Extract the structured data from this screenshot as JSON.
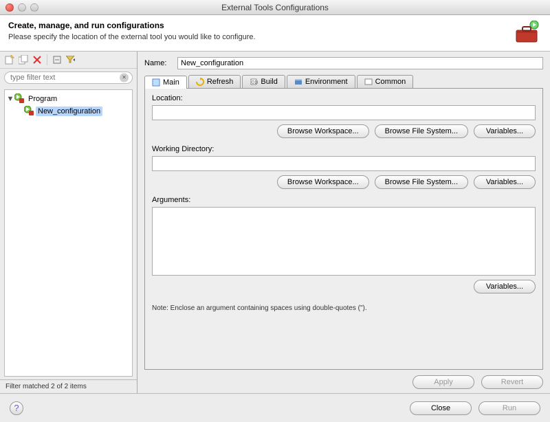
{
  "window": {
    "title": "External Tools Configurations"
  },
  "header": {
    "title": "Create, manage, and run configurations",
    "subtitle": "Please specify the location of the external tool you would like to configure."
  },
  "toolbar": {
    "icons": [
      "new-icon",
      "duplicate-icon",
      "delete-icon",
      "collapse-icon",
      "filter-icon"
    ]
  },
  "filter": {
    "placeholder": "type filter text",
    "value": "",
    "status": "Filter matched 2 of 2 items"
  },
  "tree": {
    "root": {
      "label": "Program",
      "expanded": true
    },
    "children": [
      {
        "label": "New_configuration",
        "selected": true
      }
    ]
  },
  "form": {
    "name_label": "Name:",
    "name_value": "New_configuration"
  },
  "tabs": {
    "items": [
      {
        "label": "Main",
        "active": true
      },
      {
        "label": "Refresh"
      },
      {
        "label": "Build"
      },
      {
        "label": "Environment"
      },
      {
        "label": "Common"
      }
    ]
  },
  "main_tab": {
    "location_label": "Location:",
    "location_value": "",
    "wd_label": "Working Directory:",
    "wd_value": "",
    "args_label": "Arguments:",
    "args_value": "",
    "note": "Note: Enclose an argument containing spaces using double-quotes (\").",
    "buttons": {
      "browse_ws": "Browse Workspace...",
      "browse_fs": "Browse File System...",
      "variables": "Variables..."
    }
  },
  "actions": {
    "apply": "Apply",
    "revert": "Revert",
    "close": "Close",
    "run": "Run"
  }
}
